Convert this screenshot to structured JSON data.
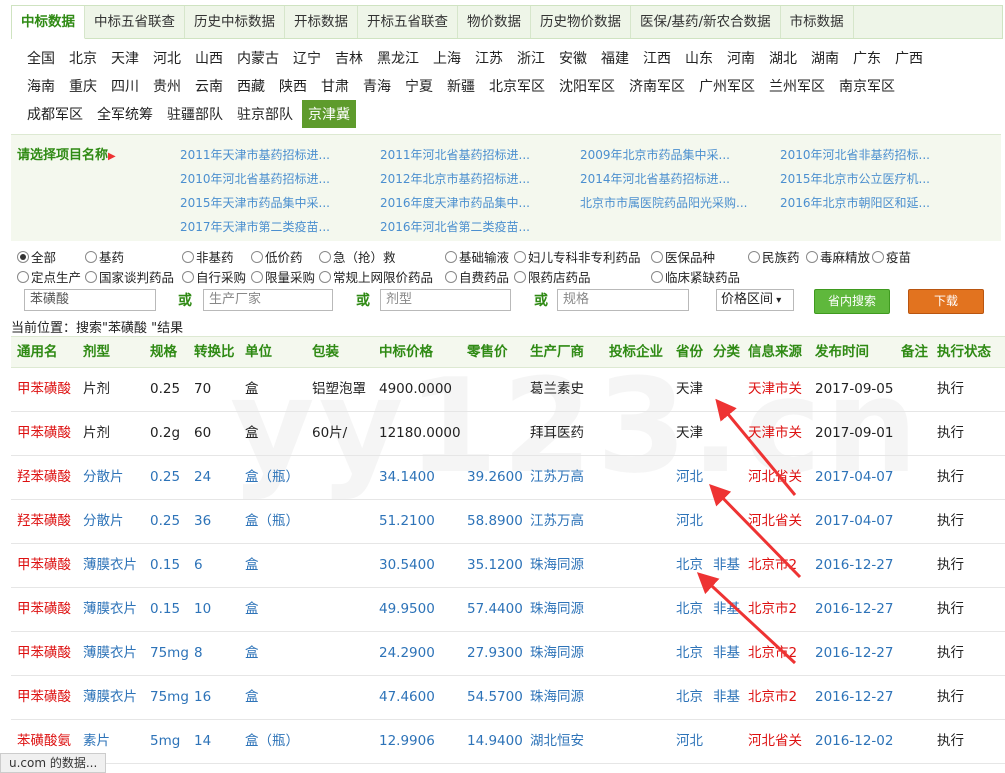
{
  "tabs": [
    "中标数据",
    "中标五省联查",
    "历史中标数据",
    "开标数据",
    "开标五省联查",
    "物价数据",
    "历史物价数据",
    "医保/基药/新农合数据",
    "市标数据"
  ],
  "regions": [
    [
      "全国",
      "北京",
      "天津",
      "河北",
      "山西",
      "内蒙古",
      "辽宁",
      "吉林",
      "黑龙江",
      "上海",
      "江苏",
      "浙江",
      "安徽",
      "福建",
      "江西",
      "山东",
      "河南",
      "湖北",
      "湖南",
      "广东",
      "广西"
    ],
    [
      "海南",
      "重庆",
      "四川",
      "贵州",
      "云南",
      "西藏",
      "陕西",
      "甘肃",
      "青海",
      "宁夏",
      "新疆",
      "北京军区",
      "沈阳军区",
      "济南军区",
      "广州军区",
      "兰州军区",
      "南京军区"
    ],
    [
      "成都军区",
      "全军统筹",
      "驻疆部队",
      "驻京部队",
      "京津冀"
    ]
  ],
  "project": {
    "title": "请选择项目名称",
    "links": [
      [
        "2011年天津市基药招标进...",
        "2011年河北省基药招标进...",
        "2009年北京市药品集中采...",
        "2010年河北省非基药招标..."
      ],
      [
        "2010年河北省基药招标进...",
        "2012年北京市基药招标进...",
        "2014年河北省基药招标进...",
        "2015年北京市公立医疗机..."
      ],
      [
        "2015年天津市药品集中采...",
        "2016年度天津市药品集中...",
        "北京市市属医院药品阳光采购...",
        "2016年北京市朝阳区和延..."
      ],
      [
        "2017年天津市第二类疫苗...",
        "2016年河北省第二类疫苗..."
      ]
    ]
  },
  "options": {
    "row1": [
      "全部",
      "基药",
      "非基药",
      "低价药",
      "急（抢）救",
      "基础输液",
      "妇儿专科非专利药品",
      "医保品种",
      "民族药",
      "毒麻精放",
      "疫苗"
    ],
    "row2": [
      "定点生产",
      "国家谈判药品",
      "自行采购",
      "限量采购",
      "常规上网限价药品",
      "自费药品",
      "限药店药品",
      "临床紧缺药品"
    ]
  },
  "search": {
    "name_value": "苯磺酸",
    "manufacturer_placeholder": "生产厂家",
    "form_placeholder": "剂型",
    "spec_placeholder": "规格",
    "or": "或",
    "price": "价格区间",
    "search_btn": "省内搜索",
    "download_btn": "下载"
  },
  "location": "当前位置：搜索\"苯磺酸 \"结果",
  "table": {
    "headers": [
      "通用名",
      "剂型",
      "规格",
      "转换比",
      "单位",
      "包装",
      "中标价格",
      "零售价",
      "生产厂商",
      "投标企业",
      "省份",
      "分类",
      "信息来源",
      "发布时间",
      "备注",
      "执行状态"
    ],
    "rows": [
      {
        "name": "甲苯磺酸",
        "form": "片剂",
        "spec": "0.25",
        "ratio": "70",
        "unit": "盒",
        "pack": "铝塑泡罩",
        "price": "4900.0000",
        "retail": "",
        "maker": "葛兰素史",
        "bidder": "",
        "prov": "天津",
        "cat": "",
        "src": "天津市关",
        "date": "2017-09-05",
        "note": "",
        "status": "执行",
        "style": "dark"
      },
      {
        "name": "甲苯磺酸",
        "form": "片剂",
        "spec": "0.2g",
        "ratio": "60",
        "unit": "盒",
        "pack": "60片/",
        "price": "12180.0000",
        "retail": "",
        "maker": "拜耳医药",
        "bidder": "",
        "prov": "天津",
        "cat": "",
        "src": "天津市关",
        "date": "2017-09-01",
        "note": "",
        "status": "执行",
        "style": "dark"
      },
      {
        "name": "羟苯磺酸",
        "form": "分散片",
        "spec": "0.25",
        "ratio": "24",
        "unit": "盒（瓶）",
        "pack": "",
        "price": "34.1400",
        "retail": "39.2600",
        "maker": "江苏万高",
        "bidder": "",
        "prov": "河北",
        "cat": "",
        "src": "河北省关",
        "date": "2017-04-07",
        "note": "",
        "status": "执行",
        "style": "blue"
      },
      {
        "name": "羟苯磺酸",
        "form": "分散片",
        "spec": "0.25",
        "ratio": "36",
        "unit": "盒（瓶）",
        "pack": "",
        "price": "51.2100",
        "retail": "58.8900",
        "maker": "江苏万高",
        "bidder": "",
        "prov": "河北",
        "cat": "",
        "src": "河北省关",
        "date": "2017-04-07",
        "note": "",
        "status": "执行",
        "style": "blue"
      },
      {
        "name": "甲苯磺酸",
        "form": "薄膜衣片",
        "spec": "0.15",
        "ratio": "6",
        "unit": "盒",
        "pack": "",
        "price": "30.5400",
        "retail": "35.1200",
        "maker": "珠海同源",
        "bidder": "",
        "prov": "北京",
        "cat": "非基",
        "src": "北京市2",
        "date": "2016-12-27",
        "note": "",
        "status": "执行",
        "style": "blue"
      },
      {
        "name": "甲苯磺酸",
        "form": "薄膜衣片",
        "spec": "0.15",
        "ratio": "10",
        "unit": "盒",
        "pack": "",
        "price": "49.9500",
        "retail": "57.4400",
        "maker": "珠海同源",
        "bidder": "",
        "prov": "北京",
        "cat": "非基",
        "src": "北京市2",
        "date": "2016-12-27",
        "note": "",
        "status": "执行",
        "style": "blue"
      },
      {
        "name": "甲苯磺酸",
        "form": "薄膜衣片",
        "spec": "75mg",
        "ratio": "8",
        "unit": "盒",
        "pack": "",
        "price": "24.2900",
        "retail": "27.9300",
        "maker": "珠海同源",
        "bidder": "",
        "prov": "北京",
        "cat": "非基",
        "src": "北京市2",
        "date": "2016-12-27",
        "note": "",
        "status": "执行",
        "style": "blue"
      },
      {
        "name": "甲苯磺酸",
        "form": "薄膜衣片",
        "spec": "75mg",
        "ratio": "16",
        "unit": "盒",
        "pack": "",
        "price": "47.4600",
        "retail": "54.5700",
        "maker": "珠海同源",
        "bidder": "",
        "prov": "北京",
        "cat": "非基",
        "src": "北京市2",
        "date": "2016-12-27",
        "note": "",
        "status": "执行",
        "style": "blue"
      },
      {
        "name": "苯磺酸氨",
        "form": "素片",
        "spec": "5mg",
        "ratio": "14",
        "unit": "盒（瓶）",
        "pack": "",
        "price": "12.9906",
        "retail": "14.9400",
        "maker": "湖北恒安",
        "bidder": "",
        "prov": "河北",
        "cat": "",
        "src": "河北省关",
        "date": "2016-12-02",
        "note": "",
        "status": "执行",
        "style": "blue"
      }
    ]
  },
  "watermark": "yy123.cn",
  "status_bar": "u.com 的数据..."
}
